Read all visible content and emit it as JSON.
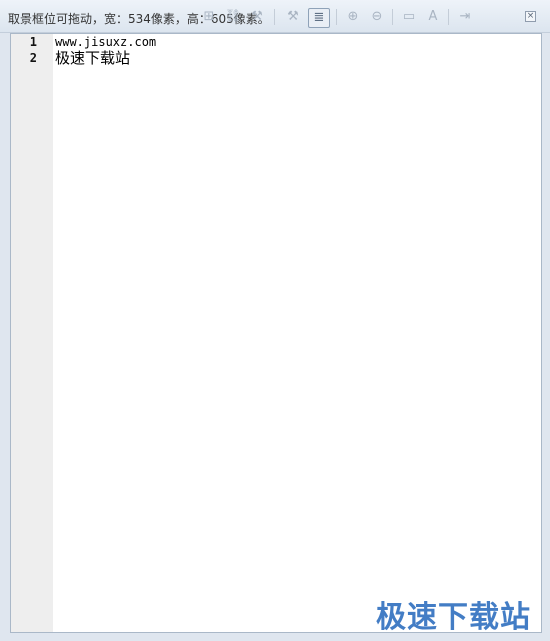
{
  "toolbar": {
    "capture_status": "取景框位可拖动，宽：534像素，高：605像素。",
    "icons": [
      {
        "name": "arrange-icon",
        "glyph": "⊞",
        "active": false
      },
      {
        "name": "link-icon",
        "glyph": "⛓",
        "active": false
      },
      {
        "name": "tool-icon",
        "glyph": "⚒",
        "active": false
      },
      {
        "name": "wrap-icon",
        "glyph": "≣",
        "active": true
      },
      {
        "name": "zoom-in-icon",
        "glyph": "⊕",
        "active": false
      },
      {
        "name": "zoom-out-icon",
        "glyph": "⊖",
        "active": false
      },
      {
        "name": "panel-icon",
        "glyph": "▭",
        "active": false
      },
      {
        "name": "font-icon",
        "glyph": "A",
        "active": false
      },
      {
        "name": "export-icon",
        "glyph": "⇥",
        "active": false
      }
    ],
    "close_glyph": "×"
  },
  "editor": {
    "lines": [
      {
        "number": "1",
        "text": "www.jisuxz.com"
      },
      {
        "number": "2",
        "text": "极速下载站"
      }
    ]
  },
  "watermark": "极速下载站"
}
